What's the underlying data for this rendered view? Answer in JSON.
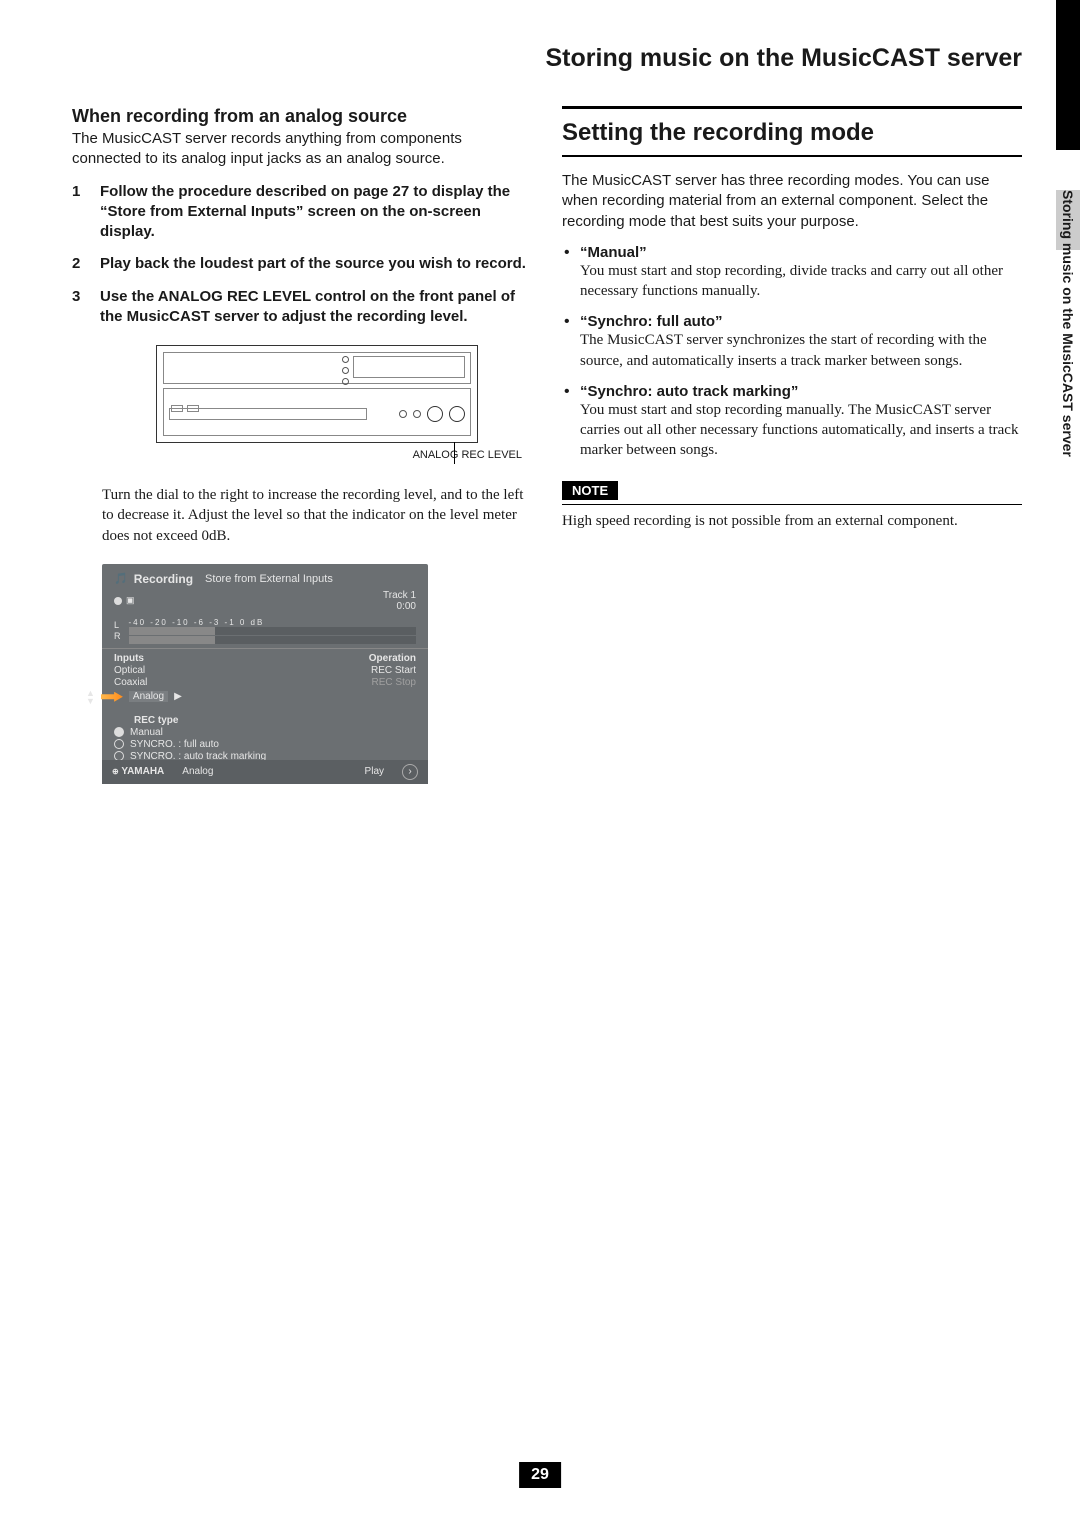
{
  "page_title": "Storing music on the MusicCAST server",
  "side_tab": "Storing music on the MusicCAST server",
  "left": {
    "h2": "When recording from an analog source",
    "intro": "The MusicCAST server records anything from components connected to its analog input jacks as an analog source.",
    "steps": [
      "Follow the procedure described on page 27 to display the “Store from External Inputs” screen on the on-screen display.",
      "Play back the loudest part of the source you wish to record.",
      "Use the ANALOG REC LEVEL control on the front panel of the MusicCAST server to adjust the recording level."
    ],
    "figure_caption": "ANALOG REC LEVEL",
    "after_figure": "Turn the dial to the right to increase the recording level, and to the left to decrease it. Adjust the level so that the indicator on the level meter does not exceed 0dB.",
    "screenshot": {
      "title": "Recording",
      "subtitle": "Store from External Inputs",
      "track_label": "Track   1",
      "time": "0:00",
      "meter_marks": "-40 -20 -10  -6  -3  -1   0   dB",
      "lr_l": "L",
      "lr_r": "R",
      "inputs_header": "Inputs",
      "inputs": [
        "Optical",
        "Coaxial",
        "Analog"
      ],
      "operation_header": "Operation",
      "operations": [
        "REC Start",
        "REC Stop"
      ],
      "rectype_header": "REC type",
      "rectypes": [
        "Manual",
        "SYNCRO. : full auto",
        "SYNCRO. : auto track marking"
      ],
      "brand": "YAMAHA",
      "bottom_input": "Analog",
      "bottom_state": "Play"
    }
  },
  "right": {
    "section_title": "Setting the recording mode",
    "intro": "The MusicCAST server has three recording modes. You can use when recording material from an external component. Select the recording mode that best suits your purpose.",
    "modes": [
      {
        "name": "“Manual”",
        "desc": "You must start and stop recording, divide tracks and carry out all other necessary functions manually."
      },
      {
        "name": "“Synchro: full auto”",
        "desc": "The MusicCAST server synchronizes the start of recording with the source, and automatically inserts a track marker between songs."
      },
      {
        "name": "“Synchro: auto track marking”",
        "desc": "You must start and stop recording manually. The MusicCAST server carries out all other necessary functions automatically, and inserts a track marker between songs."
      }
    ],
    "note_label": "NOTE",
    "note_body": "High speed recording is not possible from an external component."
  },
  "page_number": "29"
}
